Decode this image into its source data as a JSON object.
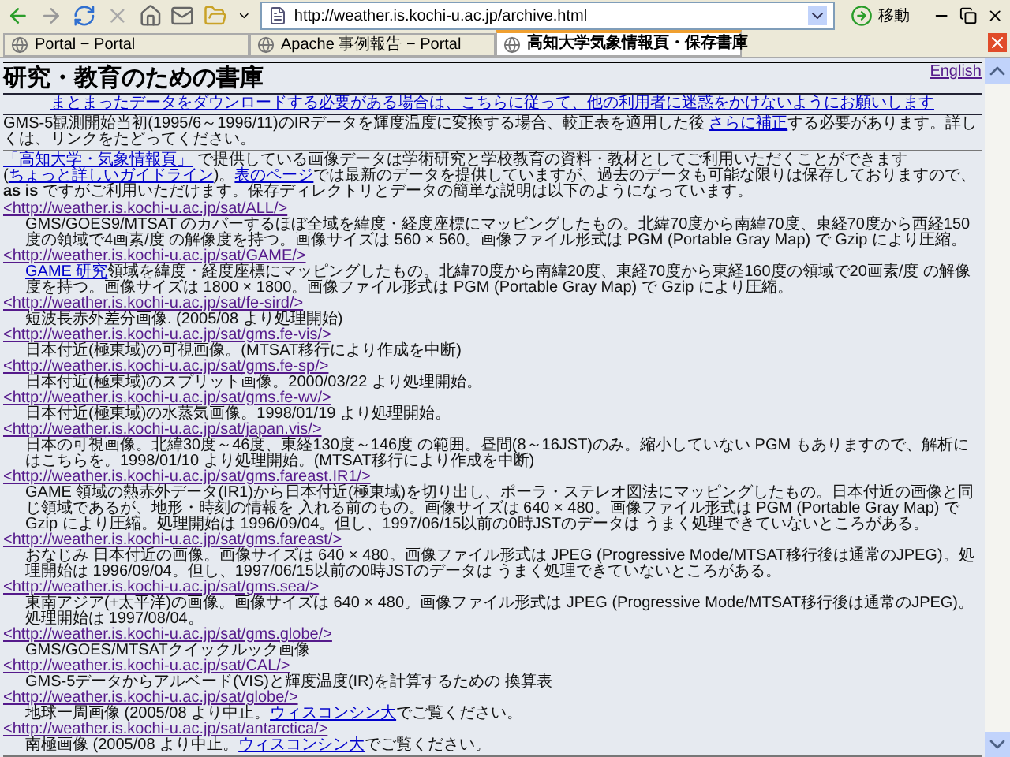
{
  "toolbar": {
    "address": "http://weather.is.kochi-u.ac.jp/archive.html",
    "go_label": "移動"
  },
  "tabs": [
    {
      "label": "Portal − Portal",
      "selected": false
    },
    {
      "label": "Apache 事例報告 − Portal",
      "selected": false
    },
    {
      "label": "高知大学気象情報頁・保存書庫",
      "selected": true
    }
  ],
  "page": {
    "language_link": "English",
    "heading": "研究・教育のための書庫",
    "notice_link": "まとまったデータをダウンロードする必要がある場合は、こちらに従って、他の利用者に迷惑をかけないようにお願いします",
    "note": [
      {
        "text": "GMS-5観測開始当初(1995/6～1996/11)のIRデータを輝度温度に変換する場合、較正表を適用した後 ",
        "link": false
      },
      {
        "text": "さらに補正",
        "link": true
      },
      {
        "text": "する必要があります。詳しくは、リンクをたどってください。",
        "link": false
      }
    ],
    "intro": [
      {
        "text": "「高知大学・気象情報頁」",
        "link": true
      },
      {
        "text": " で提供している画像データは学術研究と学校教育の資料・教材としてご利用いただくことができます (",
        "link": false
      },
      {
        "text": "ちょっと詳しいガイドライン",
        "link": true
      },
      {
        "text": ")。",
        "link": false
      },
      {
        "text": "表のページ",
        "link": true
      },
      {
        "text": "では最新のデータを提供していますが、過去のデータも可能な限りは保存しておりますので、**as is** ですがご利用いただけます。保存ディレクトリとデータの簡単な説明は以下のようになっています。",
        "link": false
      }
    ],
    "entries": [
      {
        "url": "<http://weather.is.kochi-u.ac.jp/sat/ALL/>",
        "description": [
          {
            "text": "GMS/GOES9/MTSAT のカバーするほぼ全域を緯度・経度座標にマッピングしたもの。北緯70度から南緯70度、東経70度から西経150度の領域で4画素/度 の解像度を持つ。画像サイズは 560 × 560。画像ファイル形式は PGM (Portable Gray Map) で Gzip により圧縮。",
            "link": false
          }
        ]
      },
      {
        "url": "<http://weather.is.kochi-u.ac.jp/sat/GAME/>",
        "description": [
          {
            "text": "GAME 研究",
            "link": true
          },
          {
            "text": "領域を緯度・経度座標にマッピングしたもの。北緯70度から南緯20度、東経70度から東経160度の領域で20画素/度 の解像度を持つ。画像サイズは 1800 × 1800。画像ファイル形式は PGM (Portable Gray Map) で Gzip により圧縮。",
            "link": false
          }
        ]
      },
      {
        "url": "<http://weather.is.kochi-u.ac.jp/sat/fe-sird/>",
        "description": [
          {
            "text": "短波長赤外差分画像. (2005/08 より処理開始)",
            "link": false
          }
        ]
      },
      {
        "url": "<http://weather.is.kochi-u.ac.jp/sat/gms.fe-vis/>",
        "description": [
          {
            "text": "日本付近(極東域)の可視画像。(MTSAT移行により作成を中断)",
            "link": false
          }
        ]
      },
      {
        "url": "<http://weather.is.kochi-u.ac.jp/sat/gms.fe-sp/>",
        "description": [
          {
            "text": "日本付近(極東域)のスプリット画像。2000/03/22 より処理開始。",
            "link": false
          }
        ]
      },
      {
        "url": "<http://weather.is.kochi-u.ac.jp/sat/gms.fe-wv/>",
        "description": [
          {
            "text": "日本付近(極東域)の水蒸気画像。1998/01/19 より処理開始。",
            "link": false
          }
        ]
      },
      {
        "url": "<http://weather.is.kochi-u.ac.jp/sat/japan.vis/>",
        "description": [
          {
            "text": "日本の可視画像。北緯30度～46度、東経130度～146度 の範囲。昼間(8～16JST)のみ。縮小していない PGM もありますので、解析にはこちらを。1998/01/10 より処理開始。(MTSAT移行により作成を中断)",
            "link": false
          }
        ]
      },
      {
        "url": "<http://weather.is.kochi-u.ac.jp/sat/gms.fareast.IR1/>",
        "description": [
          {
            "text": "GAME 領域の熱赤外データ(IR1)から日本付近(極東域)を切り出し、ポーラ・ステレオ図法にマッピングしたもの。日本付近の画像と同じ領域であるが、地形・時刻の情報を 入れる前のもの。画像サイズは 640 × 480。画像ファイル形式は PGM (Portable Gray Map) で Gzip により圧縮。処理開始は 1996/09/04。但し、1997/06/15以前の0時JSTのデータは うまく処理できていないところがある。",
            "link": false
          }
        ]
      },
      {
        "url": "<http://weather.is.kochi-u.ac.jp/sat/gms.fareast/>",
        "description": [
          {
            "text": "おなじみ 日本付近の画像。画像サイズは 640 × 480。画像ファイル形式は JPEG (Progressive Mode/MTSAT移行後は通常のJPEG)。処理開始は 1996/09/04。但し、1997/06/15以前の0時JSTのデータは うまく処理できていないところがある。",
            "link": false
          }
        ]
      },
      {
        "url": "<http://weather.is.kochi-u.ac.jp/sat/gms.sea/>",
        "description": [
          {
            "text": "東南アジア(+太平洋)の画像。画像サイズは 640 × 480。画像ファイル形式は JPEG (Progressive Mode/MTSAT移行後は通常のJPEG)。処理開始は 1997/08/04。",
            "link": false
          }
        ]
      },
      {
        "url": "<http://weather.is.kochi-u.ac.jp/sat/gms.globe/>",
        "description": [
          {
            "text": "GMS/GOES/MTSATクイックルック画像",
            "link": false
          }
        ]
      },
      {
        "url": "<http://weather.is.kochi-u.ac.jp/sat/CAL/>",
        "description": [
          {
            "text": "GMS-5データからアルベード(VIS)と輝度温度(IR)を計算するための 換算表",
            "link": false
          }
        ]
      },
      {
        "url": "<http://weather.is.kochi-u.ac.jp/sat/globe/>",
        "description": [
          {
            "text": "地球一周画像 (2005/08 より中止。",
            "link": false
          },
          {
            "text": "ウィスコンシン大",
            "link": true
          },
          {
            "text": "でご覧ください。",
            "link": false
          }
        ]
      },
      {
        "url": "<http://weather.is.kochi-u.ac.jp/sat/antarctica/>",
        "description": [
          {
            "text": "南極画像 (2005/08 より中止。",
            "link": false
          },
          {
            "text": "ウィスコンシン大",
            "link": true
          },
          {
            "text": "でご覧ください。",
            "link": false
          }
        ]
      }
    ]
  }
}
